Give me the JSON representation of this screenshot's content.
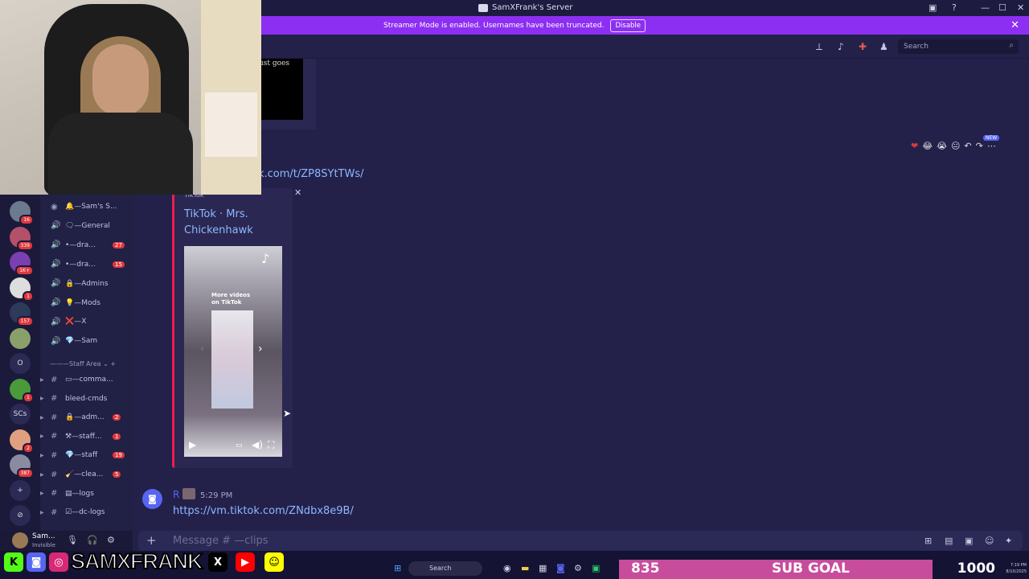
{
  "window": {
    "title": "SamXFrank's Server",
    "controls": [
      "—",
      "☐",
      "✕"
    ]
  },
  "streamer_mode": {
    "message": "Streamer Mode is enabled. Usernames have been truncated.",
    "button": "Disable",
    "close": "✕"
  },
  "toolbar": {
    "search_placeholder": "Search"
  },
  "old_embed": {
    "text": "ust goes"
  },
  "messages": {
    "link1": "ok.com/t/ZP8SYtTWs/",
    "reaction_badge": "NEW",
    "reactions": [
      "❤",
      "😂",
      "😭",
      "😐",
      "↶",
      "↷",
      "⋯"
    ]
  },
  "embed": {
    "provider": "TikTok",
    "title": "TikTok · Mrs. Chickenhawk",
    "more_videos": "More videos on TikTok",
    "close": "✕"
  },
  "message2": {
    "author": "R",
    "time": "5:29 PM",
    "link": "https://vm.tiktok.com/ZNdbx8e9B/"
  },
  "composer": {
    "placeholder": "Message #  —clips",
    "plus": "+"
  },
  "servers": [
    {
      "badge": "16"
    },
    {
      "badge": "339"
    },
    {
      "badge": "1K+"
    },
    {
      "badge": "1"
    },
    {
      "badge": "157"
    },
    {
      "badge": ""
    },
    {
      "label": "O"
    },
    {
      "badge": "1"
    },
    {
      "label": "SCs"
    },
    {
      "badge": "2"
    },
    {
      "badge": "387"
    }
  ],
  "channels": {
    "voice": [
      {
        "icon": "◉",
        "name": "🔔—Sam's S..."
      },
      {
        "icon": "🔊",
        "name": "🗨—General"
      },
      {
        "icon": "🔊",
        "name": "•—dra...",
        "badge": "27"
      },
      {
        "icon": "🔊",
        "name": "•—dra...",
        "badge": "15"
      },
      {
        "icon": "🔊",
        "name": "🔒—Admins"
      },
      {
        "icon": "🔊",
        "name": "💡—Mods"
      },
      {
        "icon": "🔊",
        "name": "❌—X"
      },
      {
        "icon": "🔊",
        "name": "💎—Sam"
      }
    ],
    "category": "Staff Area",
    "text": [
      {
        "name": "▭—comma..."
      },
      {
        "name": "bleed-cmds"
      },
      {
        "name": "🔒—adm...",
        "badge": "2"
      },
      {
        "name": "⚒—staff...",
        "badge": "1"
      },
      {
        "name": "💎—staff",
        "badge": "19"
      },
      {
        "name": "🧹—clea...",
        "badge": "5"
      },
      {
        "name": "▤—logs"
      },
      {
        "name": "☑—dc-logs"
      }
    ]
  },
  "user_panel": {
    "name": "Sam...",
    "status": "Invisible"
  },
  "overlay": {
    "brand": "SAMXFRANK",
    "sub_count": "835",
    "sub_label": "SUB GOAL",
    "sub_target": "1000",
    "clock_time": "7:19 PM",
    "clock_date": "8/10/2025"
  },
  "taskbar": {
    "search_label": "Search"
  }
}
